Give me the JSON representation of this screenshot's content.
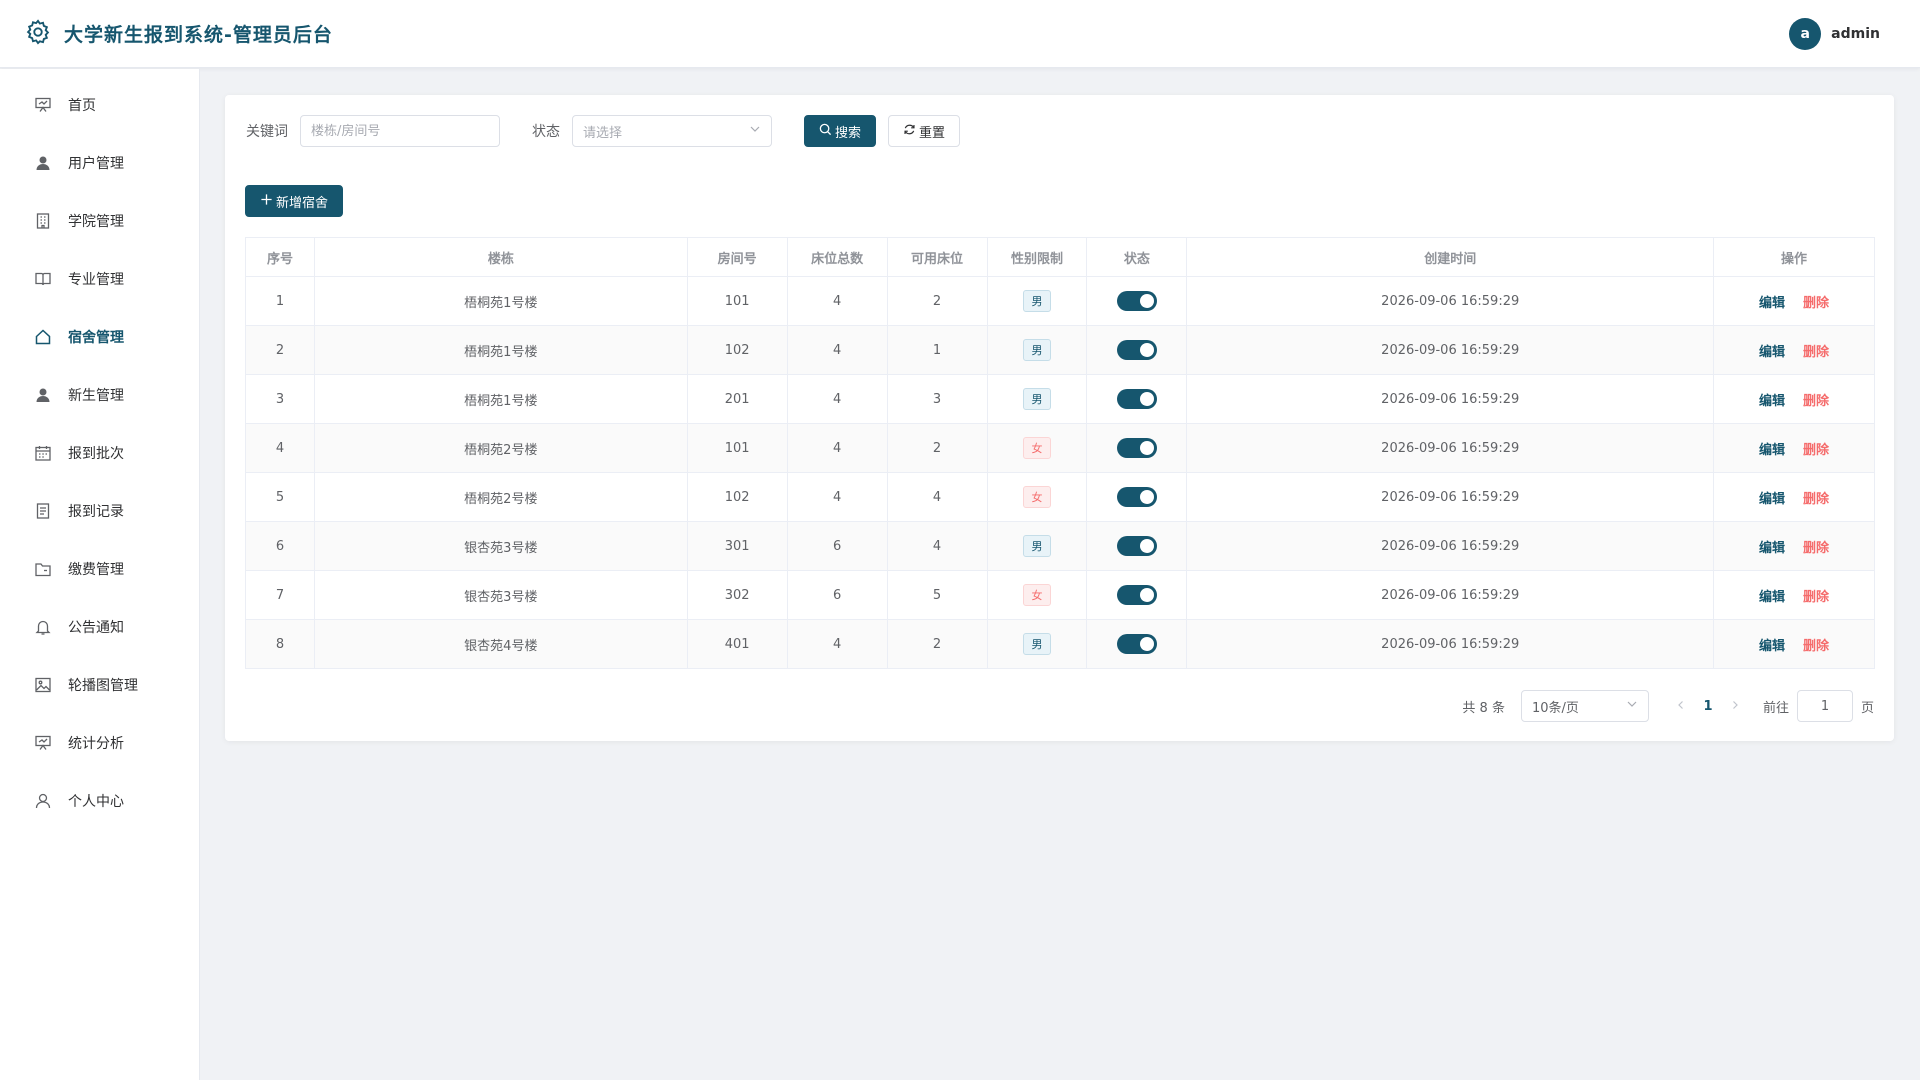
{
  "app": {
    "title": "大学新生报到系统-管理员后台"
  },
  "user": {
    "avatar_letter": "a",
    "name": "admin"
  },
  "sidebar": {
    "items": [
      {
        "label": "首页",
        "icon": "presentation-icon"
      },
      {
        "label": "用户管理",
        "icon": "user-icon"
      },
      {
        "label": "学院管理",
        "icon": "building-icon"
      },
      {
        "label": "专业管理",
        "icon": "book-icon"
      },
      {
        "label": "宿舍管理",
        "icon": "house-icon",
        "active": true
      },
      {
        "label": "新生管理",
        "icon": "user-icon"
      },
      {
        "label": "报到批次",
        "icon": "calendar-icon"
      },
      {
        "label": "报到记录",
        "icon": "document-icon"
      },
      {
        "label": "缴费管理",
        "icon": "folder-icon"
      },
      {
        "label": "公告通知",
        "icon": "bell-icon"
      },
      {
        "label": "轮播图管理",
        "icon": "picture-icon"
      },
      {
        "label": "统计分析",
        "icon": "presentation-icon"
      },
      {
        "label": "个人中心",
        "icon": "user-outline-icon"
      }
    ]
  },
  "filters": {
    "keyword_label": "关键词",
    "keyword_placeholder": "楼栋/房间号",
    "status_label": "状态",
    "status_placeholder": "请选择",
    "search_label": "搜索",
    "reset_label": "重置"
  },
  "actions": {
    "add_label": "新增宿舍"
  },
  "table": {
    "headers": [
      "序号",
      "楼栋",
      "房间号",
      "床位总数",
      "可用床位",
      "性别限制",
      "状态",
      "创建时间",
      "操作"
    ],
    "rows": [
      {
        "index": "1",
        "building": "梧桐苑1号楼",
        "room": "101",
        "beds": "4",
        "available": "2",
        "gender": "男",
        "gender_type": "male",
        "enabled": true,
        "created": "2026-09-06 16:59:29"
      },
      {
        "index": "2",
        "building": "梧桐苑1号楼",
        "room": "102",
        "beds": "4",
        "available": "1",
        "gender": "男",
        "gender_type": "male",
        "enabled": true,
        "created": "2026-09-06 16:59:29"
      },
      {
        "index": "3",
        "building": "梧桐苑1号楼",
        "room": "201",
        "beds": "4",
        "available": "3",
        "gender": "男",
        "gender_type": "male",
        "enabled": true,
        "created": "2026-09-06 16:59:29"
      },
      {
        "index": "4",
        "building": "梧桐苑2号楼",
        "room": "101",
        "beds": "4",
        "available": "2",
        "gender": "女",
        "gender_type": "female",
        "enabled": true,
        "created": "2026-09-06 16:59:29"
      },
      {
        "index": "5",
        "building": "梧桐苑2号楼",
        "room": "102",
        "beds": "4",
        "available": "4",
        "gender": "女",
        "gender_type": "female",
        "enabled": true,
        "created": "2026-09-06 16:59:29"
      },
      {
        "index": "6",
        "building": "银杏苑3号楼",
        "room": "301",
        "beds": "6",
        "available": "4",
        "gender": "男",
        "gender_type": "male",
        "enabled": true,
        "created": "2026-09-06 16:59:29"
      },
      {
        "index": "7",
        "building": "银杏苑3号楼",
        "room": "302",
        "beds": "6",
        "available": "5",
        "gender": "女",
        "gender_type": "female",
        "enabled": true,
        "created": "2026-09-06 16:59:29"
      },
      {
        "index": "8",
        "building": "银杏苑4号楼",
        "room": "401",
        "beds": "4",
        "available": "2",
        "gender": "男",
        "gender_type": "male",
        "enabled": true,
        "created": "2026-09-06 16:59:29"
      }
    ],
    "edit_label": "编辑",
    "delete_label": "删除"
  },
  "pagination": {
    "total_text": "共 8 条",
    "page_size": "10条/页",
    "current_page": "1",
    "goto_label": "前往",
    "goto_value": "1",
    "page_suffix": "页"
  },
  "colors": {
    "primary": "#16566e",
    "danger": "#f56c6c",
    "background": "#f0f2f5"
  }
}
